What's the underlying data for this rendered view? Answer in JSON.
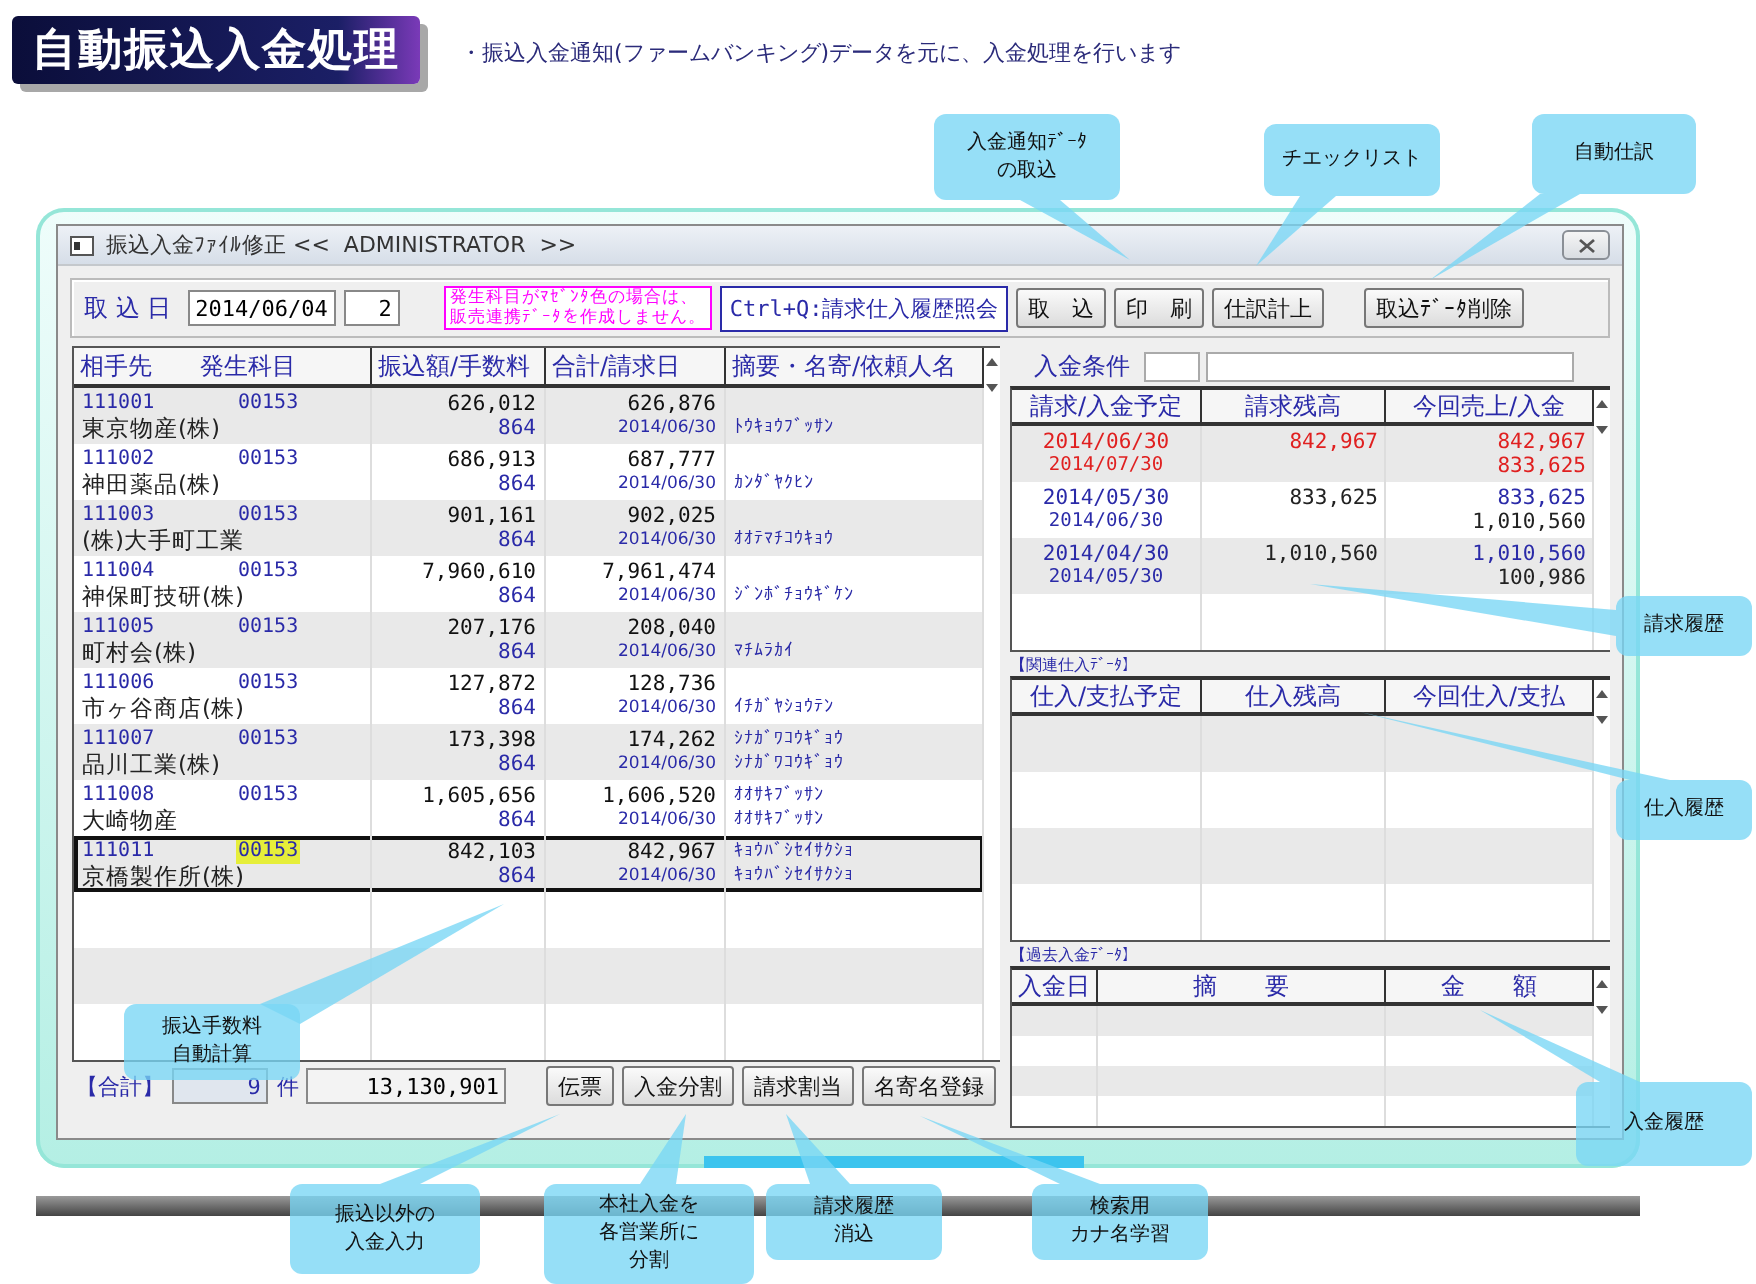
{
  "header": {
    "title": "自動振込入金処理",
    "subtitle": "・振込入金通知(ファームバンキング)データを元に、入金処理を行います"
  },
  "window": {
    "title": "振込入金ﾌｧｲﾙ修正 <<  ADMINISTRATOR  >>"
  },
  "toolbar": {
    "date_label": "取 込 日",
    "date": "2014/06/04",
    "number": "2",
    "notice": [
      "発生科目がﾏｾﾞﾝﾀ色の場合は、",
      "販売連携ﾃﾞｰﾀを作成しません。"
    ],
    "shortcut": "Ctrl+Q:請求仕入履歴照会",
    "buttons": [
      "取　込",
      "印　刷",
      "仕訳計上",
      "取込ﾃﾞｰﾀ削除"
    ]
  },
  "deposits": {
    "columns": [
      "相手先",
      "発生科目",
      "振込額/手数料",
      "合計/請求日",
      "摘要・名寄/依頼人名"
    ],
    "rows": [
      {
        "code": "111001",
        "account": "00153",
        "name": "東京物産(株)",
        "amount": "626,012",
        "fee": "864",
        "total": "626,876",
        "date": "2014/06/30",
        "memo": "ﾄｳｷｮｳﾌﾞｯｻﾝ",
        "selected": false,
        "highlighted": false
      },
      {
        "code": "111002",
        "account": "00153",
        "name": "神田薬品(株)",
        "amount": "686,913",
        "fee": "864",
        "total": "687,777",
        "date": "2014/06/30",
        "memo": "ｶﾝﾀﾞﾔｸﾋﾝ",
        "selected": false,
        "highlighted": false
      },
      {
        "code": "111003",
        "account": "00153",
        "name": "(株)大手町工業",
        "amount": "901,161",
        "fee": "864",
        "total": "902,025",
        "date": "2014/06/30",
        "memo": "ｵｵﾃﾏﾁｺｳｷｮｳ",
        "selected": false,
        "highlighted": false
      },
      {
        "code": "111004",
        "account": "00153",
        "name": "神保町技研(株)",
        "amount": "7,960,610",
        "fee": "864",
        "total": "7,961,474",
        "date": "2014/06/30",
        "memo": "ｼﾞﾝﾎﾞﾁｮｳｷﾞｹﾝ",
        "selected": false,
        "highlighted": false
      },
      {
        "code": "111005",
        "account": "00153",
        "name": "町村会(株)",
        "amount": "207,176",
        "fee": "864",
        "total": "208,040",
        "date": "2014/06/30",
        "memo": "ﾏﾁﾑﾗｶｲ",
        "selected": false,
        "highlighted": false
      },
      {
        "code": "111006",
        "account": "00153",
        "name": "市ヶ谷商店(株)",
        "amount": "127,872",
        "fee": "864",
        "total": "128,736",
        "date": "2014/06/30",
        "memo": "ｲﾁｶﾞﾔｼｮｳﾃﾝ",
        "selected": false,
        "highlighted": false
      },
      {
        "code": "111007",
        "account": "00153",
        "name": "品川工業(株)",
        "amount": "173,398",
        "fee": "864",
        "total": "174,262",
        "date": "2014/06/30",
        "memo_top": "ｼﾅｶﾞﾜｺｳｷﾞｮｳ",
        "memo": "ｼﾅｶﾞﾜｺｳｷﾞｮｳ",
        "selected": false,
        "highlighted": false
      },
      {
        "code": "111008",
        "account": "00153",
        "name": "大崎物産",
        "amount": "1,605,656",
        "fee": "864",
        "total": "1,606,520",
        "date": "2014/06/30",
        "memo_top": "ｵｵｻｷﾌﾞｯｻﾝ",
        "memo": "ｵｵｻｷﾌﾞｯｻﾝ",
        "selected": false,
        "highlighted": false
      },
      {
        "code": "111011",
        "account": "00153",
        "name": "京橋製作所(株)",
        "amount": "842,103",
        "fee": "864",
        "total": "842,967",
        "date": "2014/06/30",
        "memo_top": "ｷｮｳﾊﾞｼｾｲｻｸｼｮ",
        "memo": "ｷｮｳﾊﾞｼｾｲｻｸｼｮ",
        "selected": true,
        "highlighted": true
      }
    ]
  },
  "footer": {
    "total_label": "【合計】",
    "count": "9",
    "count_unit": "件",
    "total": "13,130,901",
    "buttons": [
      "伝票",
      "入金分割",
      "請求割当",
      "名寄名登録"
    ]
  },
  "condition": {
    "label": "入金条件"
  },
  "billing": {
    "columns": [
      "請求/入金予定",
      "請求残高",
      "今回売上/入金"
    ],
    "rows": [
      {
        "kind": "current",
        "date1": "2014/06/30",
        "date2": "2014/07/30",
        "balance": "842,967",
        "amount1": "842,967",
        "amount2": "833,625"
      },
      {
        "kind": "history",
        "date1": "2014/05/30",
        "date2": "2014/06/30",
        "balance": "833,625",
        "amount1": "833,625",
        "amount2": "1,010,560"
      },
      {
        "kind": "history",
        "date1": "2014/04/30",
        "date2": "2014/05/30",
        "balance": "1,010,560",
        "amount1": "1,010,560",
        "amount2": "100,986"
      }
    ]
  },
  "purchases": {
    "caption": "【関連仕入ﾃﾞｰﾀ】",
    "columns": [
      "仕入/支払予定",
      "仕入残高",
      "今回仕入/支払"
    ]
  },
  "past_deposits": {
    "caption": "【過去入金ﾃﾞｰﾀ】",
    "columns": [
      "入金日",
      "摘　　要",
      "金　　額"
    ]
  },
  "callouts": [
    {
      "lines": [
        "入金通知ﾃﾞｰﾀ",
        "の取込"
      ]
    },
    {
      "lines": [
        "チエックリスト"
      ]
    },
    {
      "lines": [
        "自動仕訳"
      ]
    },
    {
      "lines": [
        "振込手数料",
        "自動計算"
      ]
    },
    {
      "lines": [
        "振込以外の",
        "入金入力"
      ]
    },
    {
      "lines": [
        "本社入金を",
        "各営業所に",
        "分割"
      ]
    },
    {
      "lines": [
        "請求履歴",
        "消込"
      ]
    },
    {
      "lines": [
        "検索用",
        "カナ名学習"
      ]
    },
    {
      "lines": [
        "請求履歴"
      ]
    },
    {
      "lines": [
        "仕入履歴"
      ]
    },
    {
      "lines": [
        "入金履歴"
      ]
    }
  ]
}
